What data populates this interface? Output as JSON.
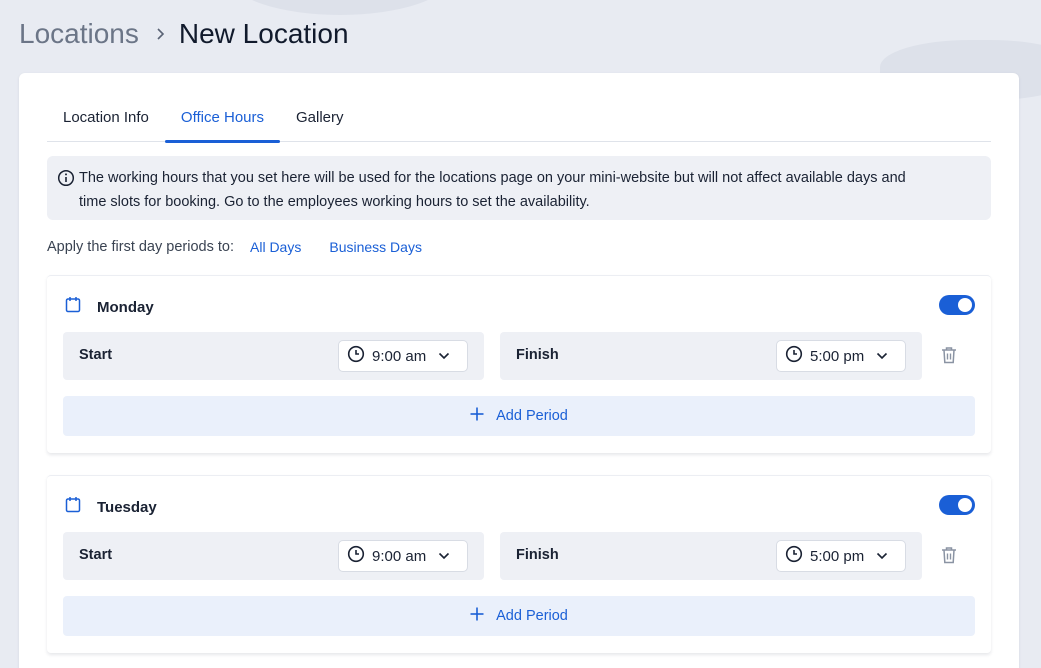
{
  "breadcrumb": {
    "parent": "Locations",
    "current": "New Location"
  },
  "tabs": [
    {
      "label": "Location Info",
      "active": false
    },
    {
      "label": "Office Hours",
      "active": true
    },
    {
      "label": "Gallery",
      "active": false
    }
  ],
  "info": {
    "line1": "The working hours that you set here will be used for the locations page on your mini-website but will not affect available days and",
    "line2": "time slots for booking. Go to the employees working hours to set the availability."
  },
  "apply": {
    "label": "Apply the first day periods to:",
    "all_days": "All Days",
    "business_days": "Business Days"
  },
  "days": [
    {
      "name": "Monday",
      "enabled": true,
      "start_label": "Start",
      "start_value": "9:00 am",
      "finish_label": "Finish",
      "finish_value": "5:00 pm",
      "add_period": "Add Period"
    },
    {
      "name": "Tuesday",
      "enabled": true,
      "start_label": "Start",
      "start_value": "9:00 am",
      "finish_label": "Finish",
      "finish_value": "5:00 pm",
      "add_period": "Add Period"
    }
  ],
  "colors": {
    "accent": "#1a5fd6",
    "background": "#e8ebf2",
    "panel": "#eef0f5"
  },
  "icons": [
    "chevron-right-icon",
    "info-icon",
    "calendar-icon",
    "clock-icon",
    "chevron-down-icon",
    "trash-icon",
    "plus-icon"
  ]
}
